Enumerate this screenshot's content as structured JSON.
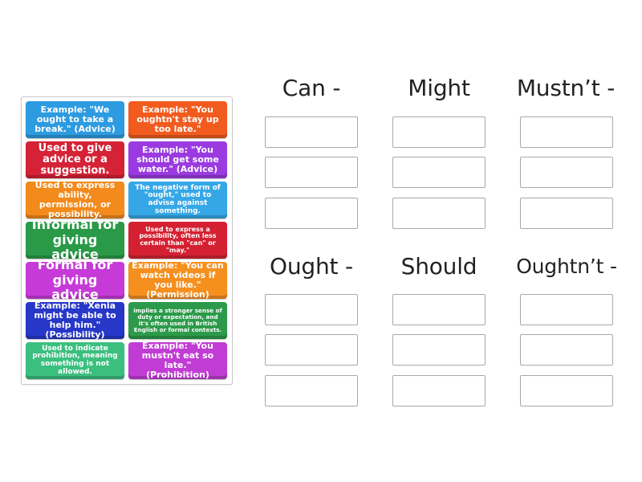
{
  "tray": {
    "cards": [
      "Example: \"We ought to take a break.\" (Advice)",
      "Example: \"You oughtn't stay up too late.\"",
      "Used to give advice or a suggestion.",
      "Example: \"You should get some water.\" (Advice)",
      "Used to express ability, permission, or possibility.",
      "The negative form of \"ought,\" used to advise against something.",
      "Informal for giving advice",
      "Used to express a possibility, often less certain than \"can\" or \"may.\"",
      "Formal for giving advice",
      "Example: \"You can watch videos if you like.\" (Permission)",
      "Example: \"Xenia might be able to help him.\" (Possibility)",
      "implies a stronger sense of duty or expectation, and it's often used in British English or formal contexts.",
      "Used to indicate prohibition, meaning something is not allowed.",
      "Example: \"You mustn't eat so late.\" (Prohibition)"
    ],
    "colors": [
      "#2d9be0",
      "#f25b1e",
      "#d52236",
      "#9a3ae0",
      "#f28a1c",
      "#36a7e6",
      "#2a9a48",
      "#d42132",
      "#c63bd8",
      "#f5901f",
      "#2737c8",
      "#2c9a4a",
      "#3bbf7f",
      "#c13cd4"
    ]
  },
  "categories": [
    {
      "title": "Can -",
      "slots": 3
    },
    {
      "title": "Might",
      "slots": 3
    },
    {
      "title": "Mustn’t -",
      "slots": 3
    },
    {
      "title": "Ought -",
      "slots": 3
    },
    {
      "title": "Should",
      "slots": 3
    },
    {
      "title": "Oughtn’t -",
      "slots": 3
    }
  ]
}
